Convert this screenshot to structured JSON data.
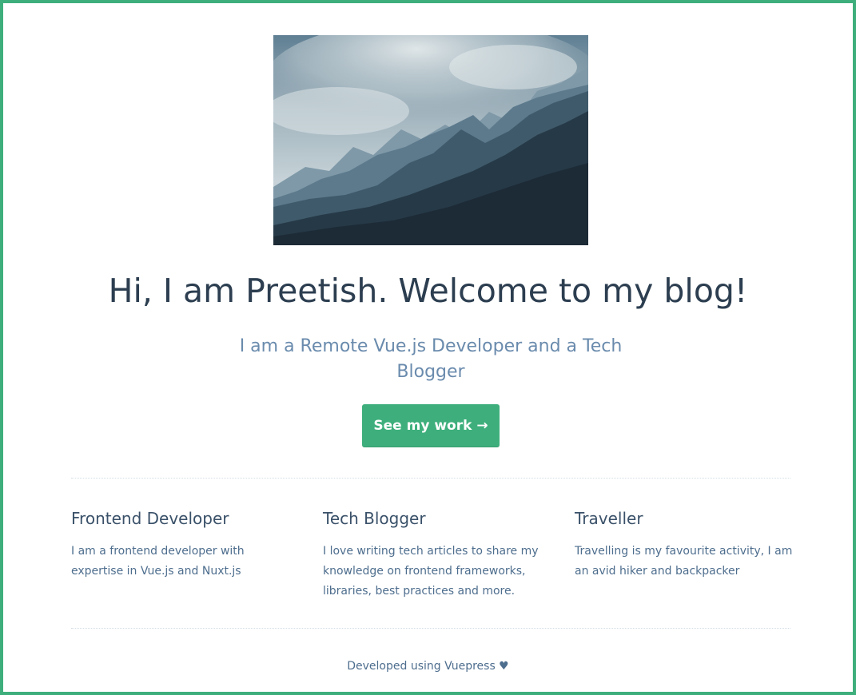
{
  "hero": {
    "image_alt": "Misty mountain range under a cloudy sky",
    "title": "Hi, I am Preetish. Welcome to my blog!",
    "tagline": "I am a Remote Vue.js Developer and a Tech Blogger",
    "cta_label": "See my work →"
  },
  "features": [
    {
      "title": "Frontend Developer",
      "details": "I am a frontend developer with expertise in Vue.js and Nuxt.js"
    },
    {
      "title": "Tech Blogger",
      "details": "I love writing tech articles to share my knowledge on frontend frameworks, libraries, best practices and more."
    },
    {
      "title": "Traveller",
      "details": "Travelling is my favourite activity, I am an avid hiker and backpacker"
    }
  ],
  "footer": {
    "text": "Developed using Vuepress ♥"
  },
  "colors": {
    "accent": "#3eaf7c",
    "heading": "#2c3e50",
    "tagline": "#6a8bad",
    "body_text": "#4e6e8e"
  }
}
